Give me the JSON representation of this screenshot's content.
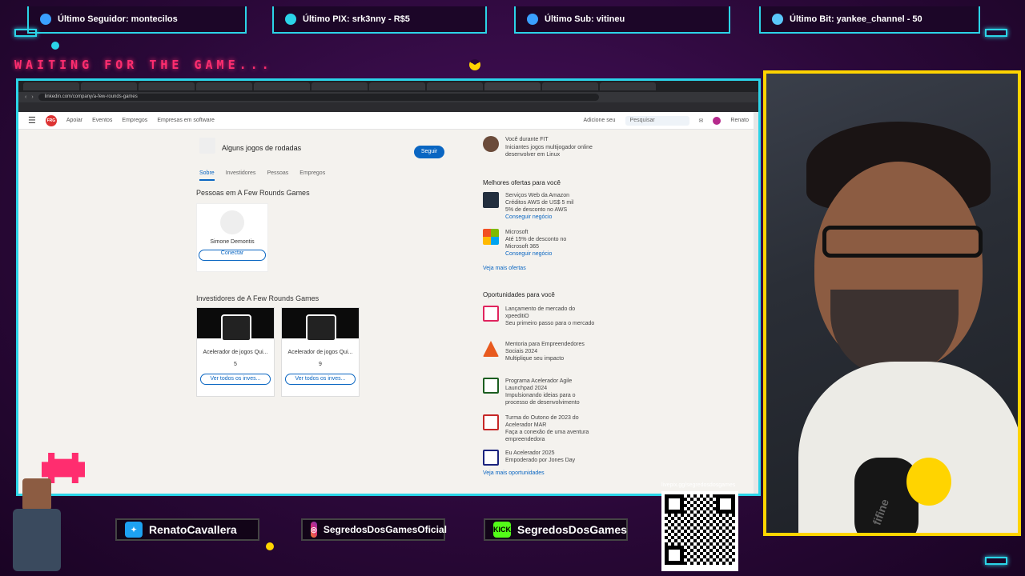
{
  "overlay": {
    "alerts": [
      {
        "label": "Último Seguidor: montecilos",
        "icon": "user-icon"
      },
      {
        "label": "Último PIX: srk3nny - R$5",
        "icon": "dollar-icon"
      },
      {
        "label": "Último Sub: vitineu",
        "icon": "star-icon"
      },
      {
        "label": "Último Bit: yankee_channel - 50",
        "icon": "diamond-icon"
      }
    ],
    "waiting_text": "WAITING FOR THE GAME...",
    "socials": [
      {
        "label": "RenatoCavallera",
        "icon": "twitter-icon"
      },
      {
        "label": "SegredosDosGamesOficial",
        "icon": "instagram-icon"
      },
      {
        "label": "SegredosDosGames",
        "icon": "kick-icon",
        "badge": "KICK"
      }
    ],
    "qr_url": "livepix.gg/segredosdosgames",
    "mic_brand": "fifine",
    "accent": "#2bd4e8",
    "highlight": "#ffd400",
    "neon_pink": "#ff2d6f"
  },
  "browser": {
    "url": "linkedin.com/company/a-few-rounds-games",
    "tab_count": 17
  },
  "linkedin": {
    "nav": [
      "Apoiar",
      "Eventos",
      "Empregos",
      "Empresas em software"
    ],
    "nav_right": "Adicione seu",
    "search_placeholder": "Pesquisar",
    "user": "Renato",
    "logo": "FRG",
    "company_name": "Alguns jogos de rodadas",
    "follow_label": "Seguir",
    "subtabs": [
      "Sobre",
      "Investidores",
      "Pessoas",
      "Empregos"
    ],
    "people_heading": "Pessoas em A Few Rounds Games",
    "person_name": "Simone Demontis",
    "connect_label": "Conectar",
    "investors_heading": "Investidores de A Few Rounds Games",
    "investors": [
      {
        "name": "Acelerador de jogos Qui...",
        "count": "5",
        "link": "Ver todos os inves..."
      },
      {
        "name": "Acelerador de jogos Qui...",
        "count": "9",
        "link": "Ver todos os inves..."
      }
    ],
    "sidebar": {
      "top_item": {
        "title": "Você durante FIT",
        "desc": "Iniciantes jogos multijogador online desenvolver em Linux"
      },
      "offers_heading": "Melhores ofertas para você",
      "offers": [
        {
          "title": "Serviços Web da Amazon",
          "desc": "Créditos AWS de US$ 5 mil",
          "desc2": "5% de desconto no AWS",
          "link": "Conseguir negócio",
          "color": "#232f3e"
        },
        {
          "title": "Microsoft",
          "desc": "Até 15% de desconto no",
          "desc2": "Microsoft 365",
          "link": "Conseguir negócio",
          "color": "#f25022"
        }
      ],
      "offers_more": "Veja mais ofertas",
      "opps_heading": "Oportunidades para você",
      "opps": [
        {
          "title": "Lançamento de mercado do xpeeditiO",
          "desc": "Seu primeiro passo para o mercado",
          "color": "#e0245e"
        },
        {
          "title": "Mentoria para Empreendedores Sociais 2024",
          "desc": "Multiplique seu impacto",
          "color": "#e85a1e"
        },
        {
          "title": "Programa Acelerador Agile Launchpad 2024",
          "desc": "Impulsionando ideias para o processo de desenvolvimento",
          "color": "#1b5e20"
        },
        {
          "title": "Turma do Outono de 2023 do Acelerador MAR",
          "desc": "Faça a conexão de uma aventura empreendedora",
          "color": "#c62828"
        },
        {
          "title": "Eu Acelerador 2025",
          "desc": "Empoderado por Jones Day",
          "color": "#1a237e"
        }
      ],
      "opps_more": "Veja mais oportunidades"
    }
  }
}
